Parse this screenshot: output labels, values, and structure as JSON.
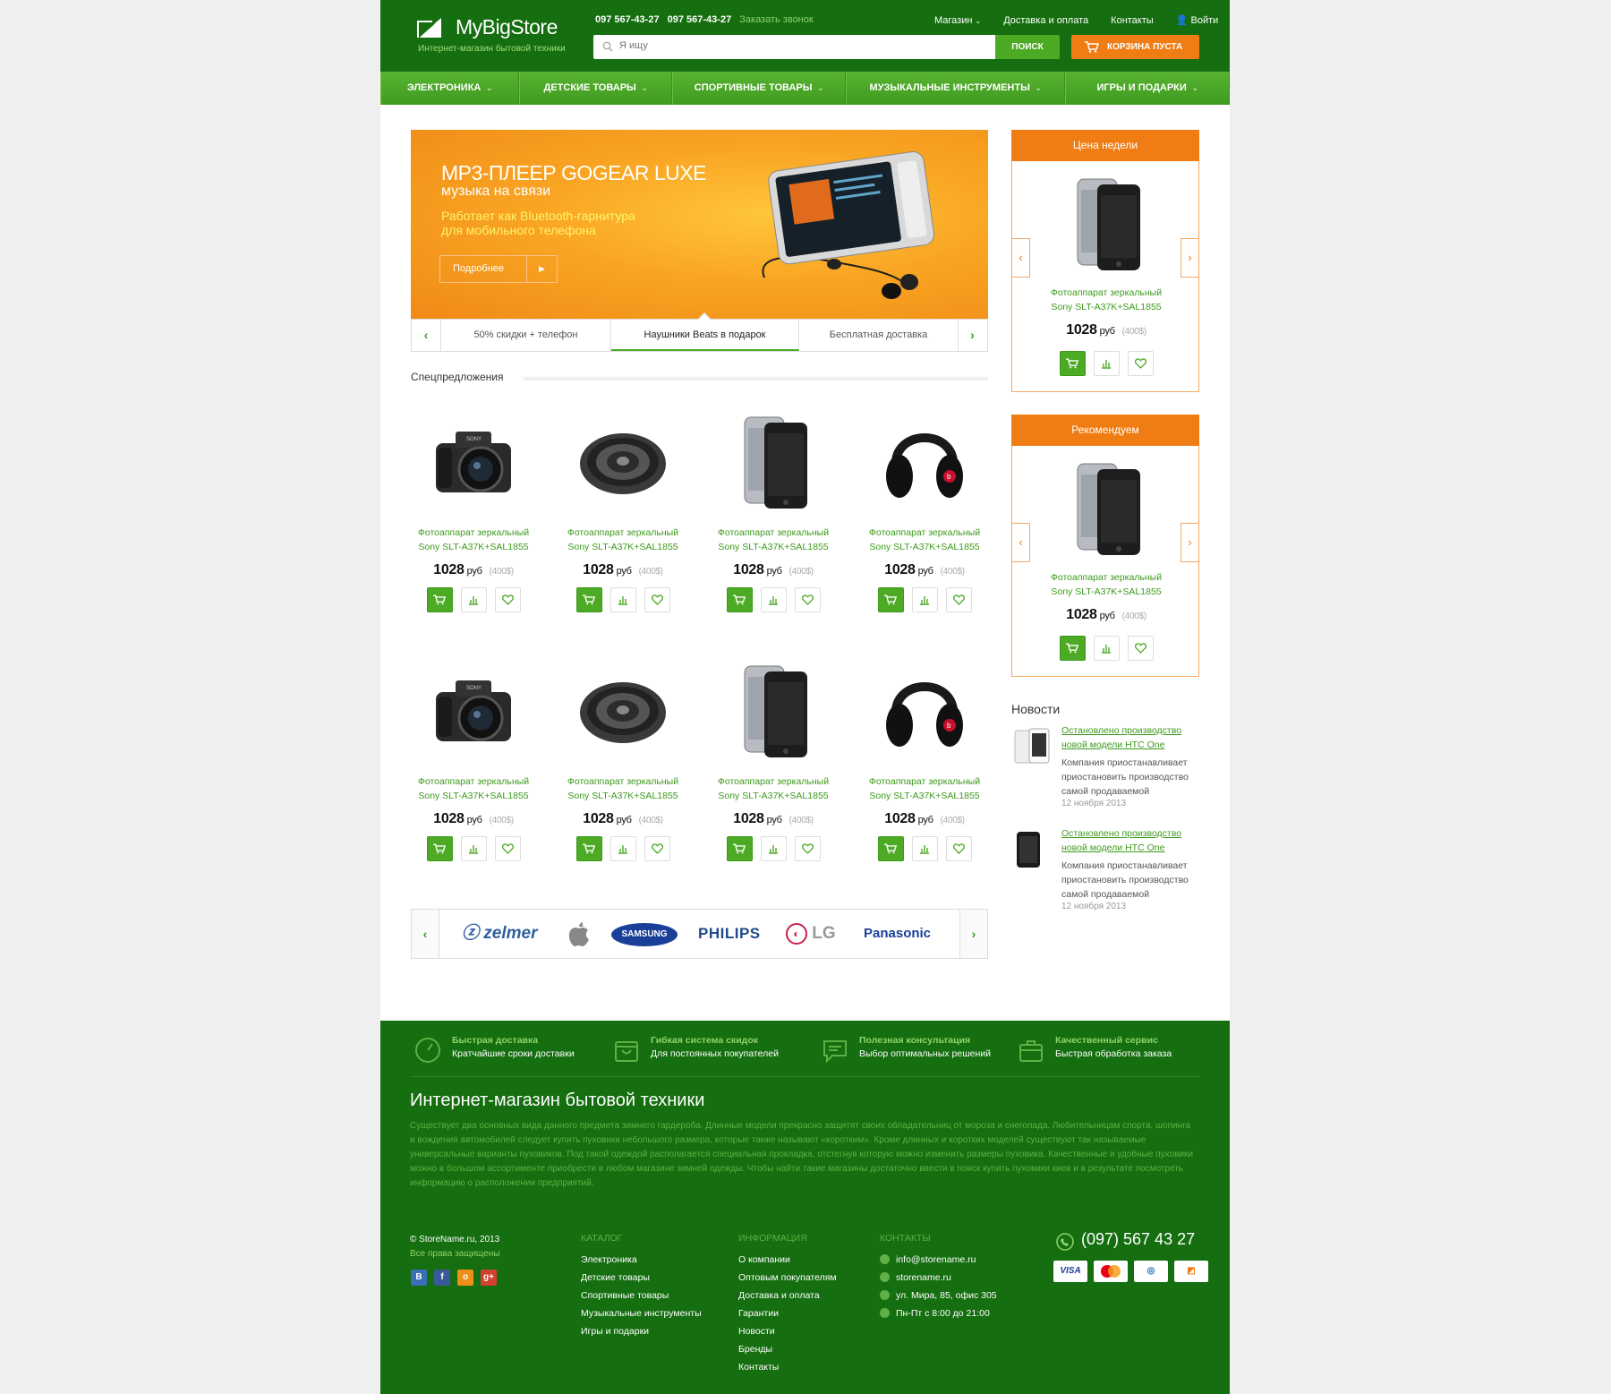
{
  "header": {
    "logo": "MyBigStore",
    "tagline": "Интернет-магазин бытовой техники",
    "phone1": "097 567-43-27",
    "phone2": "097 567-43-27",
    "callback": "Заказать звонок",
    "nav": [
      "Магазин",
      "Доставка и оплата",
      "Контакты",
      "Войти"
    ],
    "search_placeholder": "Я ищу",
    "search_button": "ПОИСК",
    "cart": "КОРЗИНА ПУСТА",
    "colors": {
      "brand_dark": "#156e10",
      "brand_green": "#4caa25",
      "accent_orange": "#f07d13"
    }
  },
  "categories": [
    "ЭЛЕКТРОНИКА",
    "ДЕТСКИЕ ТОВАРЫ",
    "СПОРТИВНЫЕ ТОВАРЫ",
    "МУЗЫКАЛЬНЫЕ ИНСТРУМЕНТЫ",
    "ИГРЫ И ПОДАРКИ"
  ],
  "banner": {
    "title": "MP3-ПЛЕЕР GOGEAR LUXE",
    "subtitle": "музыка на связи",
    "desc1": "Работает как Bluetooth-гарнитура",
    "desc2": "для мобильного телефона",
    "button": "Подробнее",
    "tabs": [
      "50% скидки + телефон",
      "Наушники Beats  в подарок",
      "Бесплатная доставка"
    ],
    "active_tab": 1
  },
  "special": {
    "title": "Спецпредложения",
    "products": [
      {
        "icon": "camera",
        "name1": "Фотоаппарат зеркальный",
        "name2": "Sony SLT-A37K+SAL1855",
        "price": "1028",
        "currency": "руб",
        "usd": "(400$)"
      },
      {
        "icon": "speaker",
        "name1": "Фотоаппарат зеркальный",
        "name2": "Sony SLT-A37K+SAL1855",
        "price": "1028",
        "currency": "руб",
        "usd": "(400$)"
      },
      {
        "icon": "phone",
        "name1": "Фотоаппарат зеркальный",
        "name2": "Sony SLT-A37K+SAL1855",
        "price": "1028",
        "currency": "руб",
        "usd": "(400$)"
      },
      {
        "icon": "headphones",
        "name1": "Фотоаппарат зеркальный",
        "name2": "Sony SLT-A37K+SAL1855",
        "price": "1028",
        "currency": "руб",
        "usd": "(400$)"
      },
      {
        "icon": "camera",
        "name1": "Фотоаппарат зеркальный",
        "name2": "Sony SLT-A37K+SAL1855",
        "price": "1028",
        "currency": "руб",
        "usd": "(400$)"
      },
      {
        "icon": "speaker",
        "name1": "Фотоаппарат зеркальный",
        "name2": "Sony SLT-A37K+SAL1855",
        "price": "1028",
        "currency": "руб",
        "usd": "(400$)"
      },
      {
        "icon": "phone",
        "name1": "Фотоаппарат зеркальный",
        "name2": "Sony SLT-A37K+SAL1855",
        "price": "1028",
        "currency": "руб",
        "usd": "(400$)"
      },
      {
        "icon": "headphones",
        "name1": "Фотоаппарат зеркальный",
        "name2": "Sony SLT-A37K+SAL1855",
        "price": "1028",
        "currency": "руб",
        "usd": "(400$)"
      }
    ]
  },
  "brands": [
    "zelmer",
    "Apple",
    "SAMSUNG",
    "PHILIPS",
    "LG",
    "Panasonic"
  ],
  "widgets": [
    {
      "title": "Цена недели",
      "name1": "Фотоаппарат зеркальный",
      "name2": "Sony SLT-A37K+SAL1855",
      "price": "1028",
      "currency": "руб",
      "usd": "(400$)"
    },
    {
      "title": "Рекомендуем",
      "name1": "Фотоаппарат зеркальный",
      "name2": "Sony SLT-A37K+SAL1855",
      "price": "1028",
      "currency": "руб",
      "usd": "(400$)"
    }
  ],
  "news": {
    "title": "Новости",
    "items": [
      {
        "t1": "Остановлено производство",
        "t2": "новой модели HTC One",
        "x1": "Компания приостанавливает",
        "x2": "приостановить производство",
        "x3": "самой продаваемой",
        "date": "12 ноября 2013"
      },
      {
        "t1": "Остановлено производство",
        "t2": "новой модели HTC One",
        "x1": "Компания приостанавливает",
        "x2": "приостановить производство",
        "x3": "самой продаваемой",
        "date": "12 ноября 2013"
      }
    ]
  },
  "footer": {
    "features": [
      {
        "icon": "speedometer",
        "t1": "Быстрая доставка",
        "t2": "Кратчайшие сроки доставки"
      },
      {
        "icon": "percent-box",
        "t1": "Гибкая система скидок",
        "t2": "Для постоянных покупателей"
      },
      {
        "icon": "chat",
        "t1": "Полезная консультация",
        "t2": "Выбор оптимальных решений"
      },
      {
        "icon": "briefcase",
        "t1": "Качественный сервис",
        "t2": "Быстрая обработка заказа"
      }
    ],
    "title": "Интернет-магазин бытовой техники",
    "text": "Существует два основных вида данного предмета зимнего гардероба. Длинные модели прекрасно защитят своих обладательниц от мороза и снегопада. Любительницам спорта, шопинга и вождения автомобилей следует купить пуховики небольшого размера, которые также называют «коротким». Кроме длинных и коротких моделей существуют так называемые универсальные варианты пуховиков. Под такой одеждой располагается специальная прокладка, отстегнув которую можно изменить размеры пуховика. Качественные и удобные пуховики можно в большом ассортименте приобрести в любом магазине зимней одежды. Чтобы найти такие магазины достаточно ввести в поиск купить пуховики киев и в результате посмотреть информацию о расположении предприятий.",
    "copyright": "© StoreName.ru, 2013",
    "rights": "Все права защищены",
    "social": [
      "В",
      "f",
      "о",
      "g+"
    ],
    "catalog_title": "КАТАЛОГ",
    "catalog": [
      "Электроника",
      "Детские товары",
      "Спортивные товары",
      "Музыкальные инструменты",
      "Игры и подарки"
    ],
    "info_title": "ИНФОРМАЦИЯ",
    "info": [
      "О компании",
      "Оптовым покупателям",
      "Доставка и оплата",
      "Гарантии",
      "Новости",
      "Бренды",
      "Контакты"
    ],
    "contacts_title": "КОНТАКТЫ",
    "contacts": [
      "info@storename.ru",
      "storename.ru",
      "ул. Мира, 85, офис 305",
      "Пн-Пт с 8:00 до 21:00"
    ],
    "phone": "(097) 567 43 27",
    "payments": [
      "VISA",
      "MasterCard",
      "Webmoney",
      "Yandex"
    ]
  }
}
